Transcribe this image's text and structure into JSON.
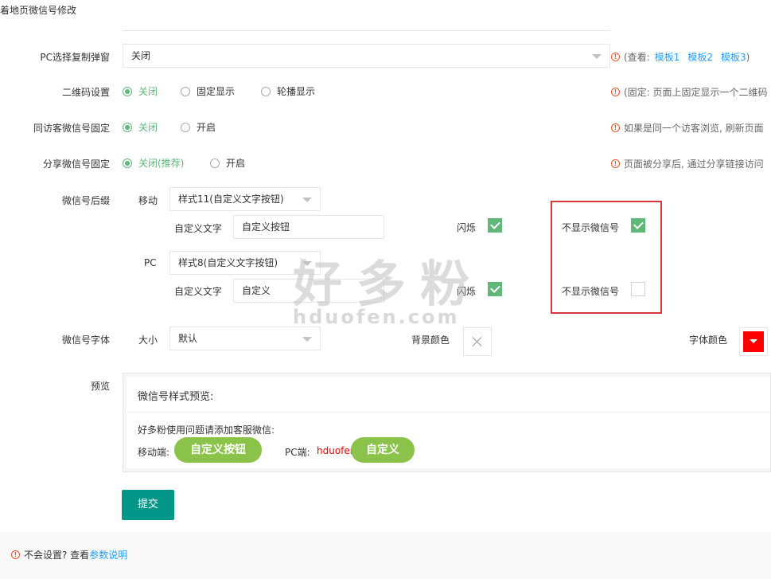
{
  "header": {
    "title": "着地页微信号修改"
  },
  "rows": {
    "pc_copy": {
      "label": "PC选择复制弹窗",
      "value": "关闭",
      "hint_prefix": "(查看:",
      "hint_links": [
        "模板1",
        "模板2",
        "模板3"
      ],
      "hint_suffix": ")"
    },
    "qrcode": {
      "label": "二维码设置",
      "options": [
        "关闭",
        "固定显示",
        "轮播显示"
      ],
      "selected": 0,
      "hint": "(固定: 页面上固定显示一个二维码"
    },
    "same_visitor": {
      "label": "同访客微信号固定",
      "options": [
        "关闭",
        "开启"
      ],
      "selected": 0,
      "hint": "如果是同一个访客浏览, 刷新页面"
    },
    "share_fixed": {
      "label": "分享微信号固定",
      "options": [
        "关闭(推荐)",
        "开启"
      ],
      "selected": 0,
      "hint": "页面被分享后, 通过分享链接访问"
    },
    "suffix": {
      "label": "微信号后缀",
      "mobile": {
        "label": "移动",
        "style": "样式11(自定义文字按钮)",
        "custom_label": "自定义文字",
        "custom_value": "自定义按钮",
        "flash_label": "闪烁",
        "flash_checked": true,
        "hide_label": "不显示微信号",
        "hide_checked": true
      },
      "pc": {
        "label": "PC",
        "style": "样式8(自定义文字按钮)",
        "custom_label": "自定义文字",
        "custom_value": "自定义",
        "flash_label": "闪烁",
        "flash_checked": true,
        "hide_label": "不显示微信号",
        "hide_checked": false
      }
    },
    "font": {
      "label": "微信号字体",
      "size_label": "大小",
      "size_value": "默认",
      "bg_label": "背景颜色",
      "color_label": "字体颜色",
      "font_color": "#ff0000"
    },
    "preview": {
      "label": "预览",
      "heading": "微信号样式预览:",
      "intro": "好多粉使用问题请添加客服微信:",
      "mobile_label": "移动端:",
      "mobile_button": "自定义按钮",
      "pc_label": "PC端:",
      "pc_text": "hduofen",
      "pc_button": "自定义"
    }
  },
  "submit_label": "提交",
  "footer": {
    "text": "不会设置? 查看",
    "link": "参数说明"
  },
  "watermark": {
    "cn": "好多粉",
    "en": "hduofen.com"
  },
  "colors": {
    "green": "#5fb878",
    "teal": "#009688",
    "link": "#1e9fff",
    "highlight_border": "#d9363e",
    "pill": "#8bc34a"
  }
}
